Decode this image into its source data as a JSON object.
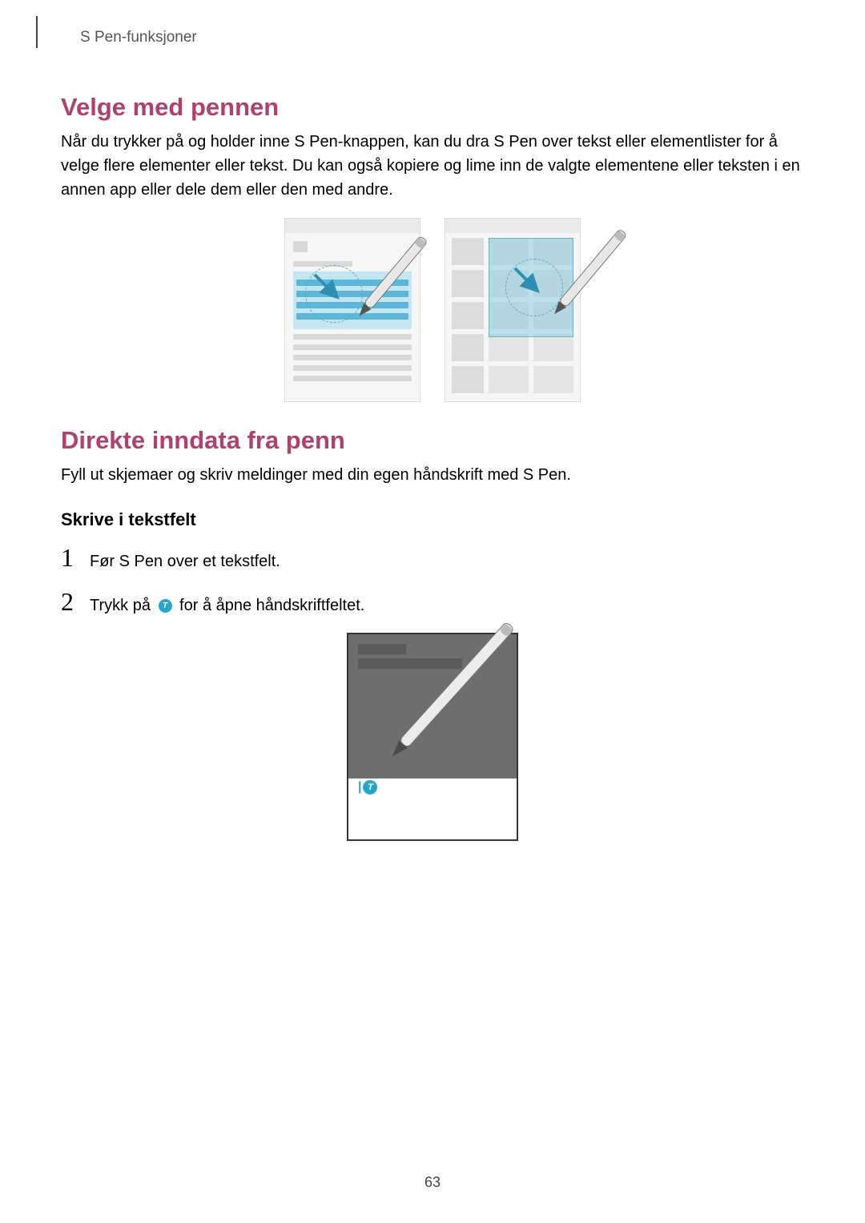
{
  "header": {
    "chapter": "S Pen-funksjoner"
  },
  "page_number": "63",
  "section1": {
    "title": "Velge med pennen",
    "body": "Når du trykker på og holder inne S Pen-knappen, kan du dra S Pen over tekst eller elementlister for å velge flere elementer eller tekst. Du kan også kopiere og lime inn de valgte elementene eller teksten i en annen app eller dele dem eller den med andre."
  },
  "section2": {
    "title": "Direkte inndata fra penn",
    "body": "Fyll ut skjemaer og skriv meldinger med din egen håndskrift med S Pen.",
    "subheading": "Skrive i tekstfelt",
    "steps": [
      {
        "n": "1",
        "text": "Før S Pen over et tekstfelt."
      },
      {
        "n": "2",
        "text_pre": "Trykk på ",
        "icon": "T",
        "text_post": " for å åpne håndskriftfeltet."
      }
    ]
  },
  "icons": {
    "handwriting_badge": "T"
  }
}
